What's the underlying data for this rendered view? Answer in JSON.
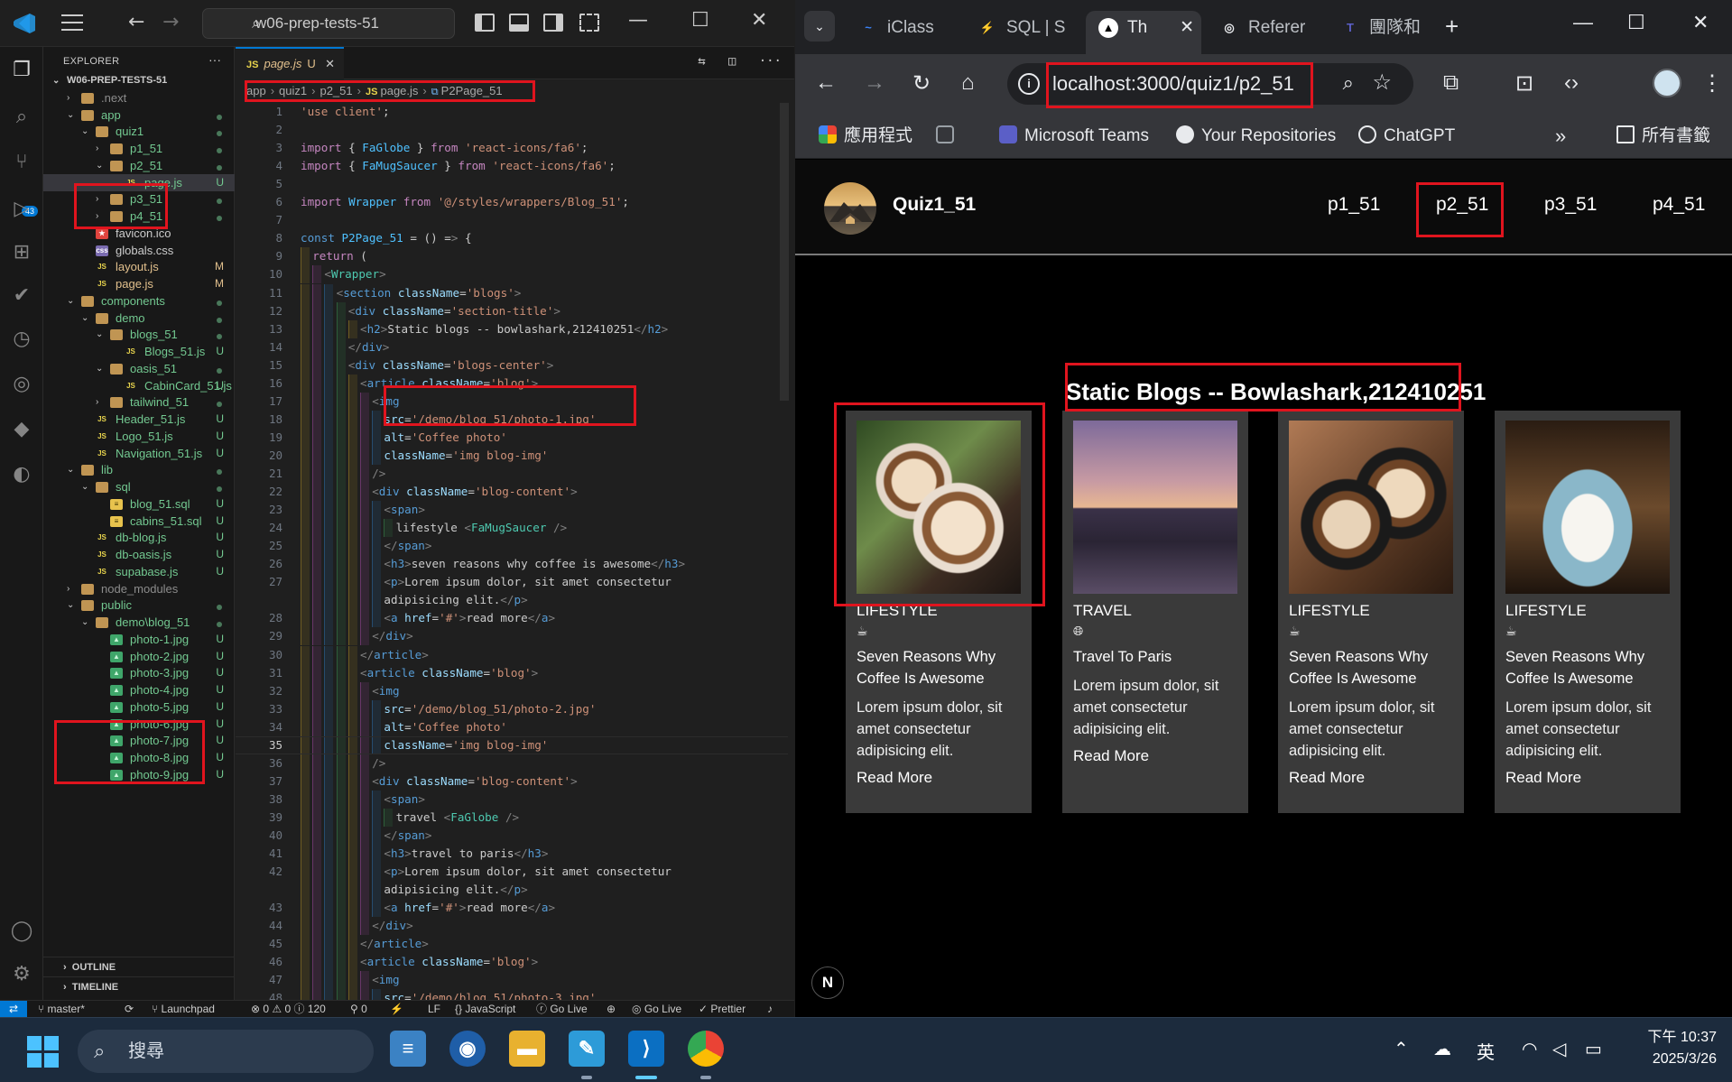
{
  "vscode": {
    "command_center": "w06-prep-tests-51",
    "explorer_title": "EXPLORER",
    "tree": [
      {
        "name": "W06-PREP-TESTS-51",
        "depth": 0,
        "type": "root",
        "open": true,
        "stat": ""
      },
      {
        "name": ".next",
        "depth": 1,
        "type": "folder",
        "open": false,
        "stat": ""
      },
      {
        "name": "app",
        "depth": 1,
        "type": "folder",
        "open": true,
        "stat": "dot"
      },
      {
        "name": "quiz1",
        "depth": 2,
        "type": "folder",
        "open": true,
        "stat": "dot"
      },
      {
        "name": "p1_51",
        "depth": 3,
        "type": "folder",
        "open": false,
        "stat": "dot"
      },
      {
        "name": "p2_51",
        "depth": 3,
        "type": "folder",
        "open": true,
        "stat": "dot"
      },
      {
        "name": "page.js",
        "depth": 4,
        "type": "js",
        "open": false,
        "stat": "U",
        "selected": true
      },
      {
        "name": "p3_51",
        "depth": 3,
        "type": "folder",
        "open": false,
        "stat": "dot"
      },
      {
        "name": "p4_51",
        "depth": 3,
        "type": "folder",
        "open": false,
        "stat": "dot"
      },
      {
        "name": "favicon.ico",
        "depth": 2,
        "type": "ico",
        "open": false,
        "stat": ""
      },
      {
        "name": "globals.css",
        "depth": 2,
        "type": "css",
        "open": false,
        "stat": ""
      },
      {
        "name": "layout.js",
        "depth": 2,
        "type": "js",
        "open": false,
        "stat": "M"
      },
      {
        "name": "page.js",
        "depth": 2,
        "type": "js",
        "open": false,
        "stat": "M"
      },
      {
        "name": "components",
        "depth": 1,
        "type": "folder",
        "open": true,
        "stat": "dot"
      },
      {
        "name": "demo",
        "depth": 2,
        "type": "folder",
        "open": true,
        "stat": "dot"
      },
      {
        "name": "blogs_51",
        "depth": 3,
        "type": "folder",
        "open": true,
        "stat": "dot"
      },
      {
        "name": "Blogs_51.js",
        "depth": 4,
        "type": "js",
        "open": false,
        "stat": "U"
      },
      {
        "name": "oasis_51",
        "depth": 3,
        "type": "folder",
        "open": true,
        "stat": "dot"
      },
      {
        "name": "CabinCard_51.js",
        "depth": 4,
        "type": "js",
        "open": false,
        "stat": "U"
      },
      {
        "name": "tailwind_51",
        "depth": 3,
        "type": "folder",
        "open": false,
        "stat": "dot"
      },
      {
        "name": "Header_51.js",
        "depth": 2,
        "type": "js",
        "open": false,
        "stat": "U"
      },
      {
        "name": "Logo_51.js",
        "depth": 2,
        "type": "js",
        "open": false,
        "stat": "U"
      },
      {
        "name": "Navigation_51.js",
        "depth": 2,
        "type": "js",
        "open": false,
        "stat": "U"
      },
      {
        "name": "lib",
        "depth": 1,
        "type": "folder",
        "open": true,
        "stat": "dot"
      },
      {
        "name": "sql",
        "depth": 2,
        "type": "folder",
        "open": true,
        "stat": "dot"
      },
      {
        "name": "blog_51.sql",
        "depth": 3,
        "type": "sql",
        "open": false,
        "stat": "U"
      },
      {
        "name": "cabins_51.sql",
        "depth": 3,
        "type": "sql",
        "open": false,
        "stat": "U"
      },
      {
        "name": "db-blog.js",
        "depth": 2,
        "type": "js",
        "open": false,
        "stat": "U"
      },
      {
        "name": "db-oasis.js",
        "depth": 2,
        "type": "js",
        "open": false,
        "stat": "U"
      },
      {
        "name": "supabase.js",
        "depth": 2,
        "type": "js",
        "open": false,
        "stat": "U"
      },
      {
        "name": "node_modules",
        "depth": 1,
        "type": "folder",
        "open": false,
        "stat": ""
      },
      {
        "name": "public",
        "depth": 1,
        "type": "folder",
        "open": true,
        "stat": "dot"
      },
      {
        "name": "demo\\blog_51",
        "depth": 2,
        "type": "folder",
        "open": true,
        "stat": "dot"
      },
      {
        "name": "photo-1.jpg",
        "depth": 3,
        "type": "img",
        "open": false,
        "stat": "U"
      },
      {
        "name": "photo-2.jpg",
        "depth": 3,
        "type": "img",
        "open": false,
        "stat": "U"
      },
      {
        "name": "photo-3.jpg",
        "depth": 3,
        "type": "img",
        "open": false,
        "stat": "U"
      },
      {
        "name": "photo-4.jpg",
        "depth": 3,
        "type": "img",
        "open": false,
        "stat": "U"
      },
      {
        "name": "photo-5.jpg",
        "depth": 3,
        "type": "img",
        "open": false,
        "stat": "U"
      },
      {
        "name": "photo-6.jpg",
        "depth": 3,
        "type": "img",
        "open": false,
        "stat": "U"
      },
      {
        "name": "photo-7.jpg",
        "depth": 3,
        "type": "img",
        "open": false,
        "stat": "U"
      },
      {
        "name": "photo-8.jpg",
        "depth": 3,
        "type": "img",
        "open": false,
        "stat": "U"
      },
      {
        "name": "photo-9.jpg",
        "depth": 3,
        "type": "img",
        "open": false,
        "stat": "U"
      }
    ],
    "outline_label": "OUTLINE",
    "timeline_label": "TIMELINE",
    "tab": {
      "label": "page.js",
      "status": "U",
      "icon": "JS"
    },
    "breadcrumb": [
      "app",
      "quiz1",
      "p2_51",
      "page.js",
      "P2Page_51"
    ],
    "code_lines": [
      {
        "n": "1",
        "text": "'use client';",
        "indent": 0
      },
      {
        "n": "2",
        "text": "",
        "indent": 0
      },
      {
        "n": "3",
        "text": "import { FaGlobe } from 'react-icons/fa6';",
        "indent": 0
      },
      {
        "n": "4",
        "text": "import { FaMugSaucer } from 'react-icons/fa6';",
        "indent": 0
      },
      {
        "n": "5",
        "text": "",
        "indent": 0
      },
      {
        "n": "6",
        "text": "import Wrapper from '@/styles/wrappers/Blog_51';",
        "indent": 0
      },
      {
        "n": "7",
        "text": "",
        "indent": 0
      },
      {
        "n": "8",
        "text": "const P2Page_51 = () => {",
        "indent": 0
      },
      {
        "n": "9",
        "text": "return (",
        "indent": 1
      },
      {
        "n": "10",
        "text": "<Wrapper>",
        "indent": 2
      },
      {
        "n": "11",
        "text": "<section className='blogs'>",
        "indent": 3
      },
      {
        "n": "12",
        "text": "<div className='section-title'>",
        "indent": 4
      },
      {
        "n": "13",
        "text": "<h2>Static blogs -- bowlashark,212410251</h2>",
        "indent": 5
      },
      {
        "n": "14",
        "text": "</div>",
        "indent": 4
      },
      {
        "n": "15",
        "text": "<div className='blogs-center'>",
        "indent": 4
      },
      {
        "n": "16",
        "text": "<article className='blog'>",
        "indent": 5
      },
      {
        "n": "17",
        "text": "<img",
        "indent": 6
      },
      {
        "n": "18",
        "text": "src='/demo/blog_51/photo-1.jpg'",
        "indent": 7
      },
      {
        "n": "19",
        "text": "alt='Coffee photo'",
        "indent": 7
      },
      {
        "n": "20",
        "text": "className='img blog-img'",
        "indent": 7
      },
      {
        "n": "21",
        "text": "/>",
        "indent": 6
      },
      {
        "n": "22",
        "text": "<div className='blog-content'>",
        "indent": 6
      },
      {
        "n": "23",
        "text": "<span>",
        "indent": 7
      },
      {
        "n": "24",
        "text": "lifestyle <FaMugSaucer />",
        "indent": 8
      },
      {
        "n": "25",
        "text": "</span>",
        "indent": 7
      },
      {
        "n": "26",
        "text": "<h3>seven reasons why coffee is awesome</h3>",
        "indent": 7
      },
      {
        "n": "27",
        "text": "<p>Lorem ipsum dolor, sit amet consectetur",
        "indent": 7
      },
      {
        "n": "",
        "text": "adipisicing elit.</p>",
        "indent": 7
      },
      {
        "n": "28",
        "text": "<a href='#'>read more</a>",
        "indent": 7
      },
      {
        "n": "29",
        "text": "</div>",
        "indent": 6
      },
      {
        "n": "30",
        "text": "</article>",
        "indent": 5
      },
      {
        "n": "31",
        "text": "<article className='blog'>",
        "indent": 5
      },
      {
        "n": "32",
        "text": "<img",
        "indent": 6
      },
      {
        "n": "33",
        "text": "src='/demo/blog_51/photo-2.jpg'",
        "indent": 7
      },
      {
        "n": "34",
        "text": "alt='Coffee photo'",
        "indent": 7
      },
      {
        "n": "35",
        "text": "className='img blog-img'",
        "indent": 7
      },
      {
        "n": "36",
        "text": "/>",
        "indent": 6
      },
      {
        "n": "37",
        "text": "<div className='blog-content'>",
        "indent": 6
      },
      {
        "n": "38",
        "text": "<span>",
        "indent": 7
      },
      {
        "n": "39",
        "text": "travel <FaGlobe />",
        "indent": 8
      },
      {
        "n": "40",
        "text": "</span>",
        "indent": 7
      },
      {
        "n": "41",
        "text": "<h3>travel to paris</h3>",
        "indent": 7
      },
      {
        "n": "42",
        "text": "<p>Lorem ipsum dolor, sit amet consectetur",
        "indent": 7
      },
      {
        "n": "",
        "text": "adipisicing elit.</p>",
        "indent": 7
      },
      {
        "n": "43",
        "text": "<a href='#'>read more</a>",
        "indent": 7
      },
      {
        "n": "44",
        "text": "</div>",
        "indent": 6
      },
      {
        "n": "45",
        "text": "</article>",
        "indent": 5
      },
      {
        "n": "46",
        "text": "<article className='blog'>",
        "indent": 5
      },
      {
        "n": "47",
        "text": "<img",
        "indent": 6
      },
      {
        "n": "48",
        "text": "src='/demo/blog_51/photo-3.jpg'",
        "indent": 7
      }
    ],
    "current_line": "35",
    "status": {
      "branch": "master*",
      "launchpad": "Launchpad",
      "problems": "⊗ 0 ⚠ 0 ⓘ 120",
      "ports": "⚲ 0",
      "eol": "LF",
      "language": "JavaScript",
      "golive1": "Go Live",
      "golive2": "Go Live",
      "prettier": "✓ Prettier"
    }
  },
  "chrome": {
    "tabs": [
      {
        "title": "iClass",
        "active": false,
        "fav_color": "#3b82f6",
        "fav": "~"
      },
      {
        "title": "SQL | S",
        "active": false,
        "fav_color": "#3ecf8e",
        "fav": "⚡"
      },
      {
        "title": "Th",
        "active": true,
        "fav_color": "#ffffff",
        "fav": "▲"
      },
      {
        "title": "Referer",
        "active": false,
        "fav_color": "#e8eaed",
        "fav": "◎"
      },
      {
        "title": "團隊和",
        "active": false,
        "fav_color": "#5b5fc7",
        "fav": "T"
      }
    ],
    "url": "localhost:3000/quiz1/p2_51",
    "bookmarks": [
      {
        "label": "應用程式",
        "color": "#ea4335"
      },
      {
        "label": "",
        "color": "#9aa0a6"
      },
      {
        "label": "Microsoft Teams",
        "color": "#5b5fc7"
      },
      {
        "label": "Your Repositories",
        "color": "#e8eaed"
      },
      {
        "label": "ChatGPT",
        "color": "#e8eaed"
      }
    ],
    "bookmarks_more": "»",
    "all_bookmarks": "所有書籤"
  },
  "site": {
    "brand": "Quiz1_51",
    "nav": [
      "p1_51",
      "p2_51",
      "p3_51",
      "p4_51"
    ],
    "title": "Static Blogs -- Bowlashark,212410251",
    "cards": [
      {
        "category": "LIFESTYLE",
        "icon": "mug-saucer-icon",
        "title": "Seven Reasons Why Coffee Is Awesome",
        "text": "Lorem ipsum dolor, sit amet consectetur adipisicing elit.",
        "link": "Read More"
      },
      {
        "category": "TRAVEL",
        "icon": "globe-icon",
        "title": "Travel To Paris",
        "text": "Lorem ipsum dolor, sit amet consectetur adipisicing elit.",
        "link": "Read More"
      },
      {
        "category": "LIFESTYLE",
        "icon": "mug-saucer-icon",
        "title": "Seven Reasons Why Coffee Is Awesome",
        "text": "Lorem ipsum dolor, sit amet consectetur adipisicing elit.",
        "link": "Read More"
      },
      {
        "category": "LIFESTYLE",
        "icon": "mug-saucer-icon",
        "title": "Seven Reasons Why Coffee Is Awesome",
        "text": "Lorem ipsum dolor, sit amet consectetur adipisicing elit.",
        "link": "Read More"
      }
    ],
    "next_badge": "N"
  },
  "taskbar": {
    "search": "搜尋",
    "ime": "英",
    "time": "下午 10:37",
    "date": "2025/3/26"
  }
}
